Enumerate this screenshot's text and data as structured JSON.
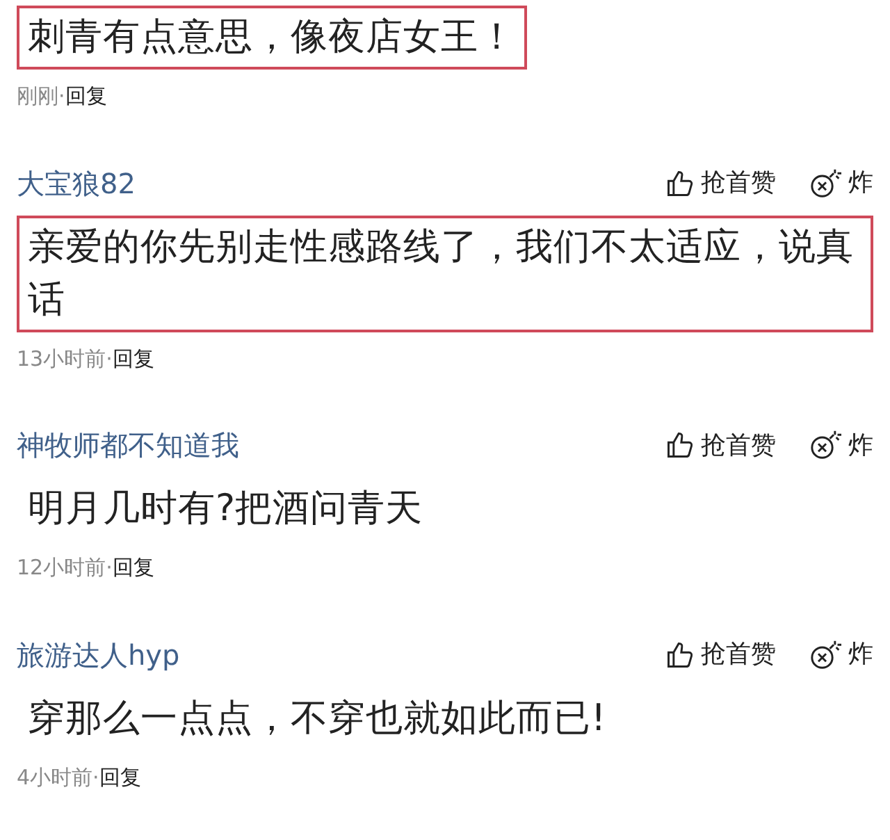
{
  "comments": [
    {
      "text": "刺青有点意思，像夜店女王！",
      "highlighted": true,
      "time": "刚刚·",
      "reply": "回复"
    },
    {
      "user": "大宝狼82",
      "like": "抢首赞",
      "bomb": "炸",
      "text": "亲爱的你先别走性感路线了，我们不太适应，说真话",
      "highlighted": true,
      "time": "13小时前·",
      "reply": "回复"
    },
    {
      "user": "神牧师都不知道我",
      "like": "抢首赞",
      "bomb": "炸",
      "text": "明月几时有?把酒问青天",
      "highlighted": false,
      "time": "12小时前·",
      "reply": "回复"
    },
    {
      "user": "旅游达人hyp",
      "like": "抢首赞",
      "bomb": "炸",
      "text": "穿那么一点点，不穿也就如此而已!",
      "highlighted": false,
      "time": "4小时前·",
      "reply": "回复"
    }
  ]
}
